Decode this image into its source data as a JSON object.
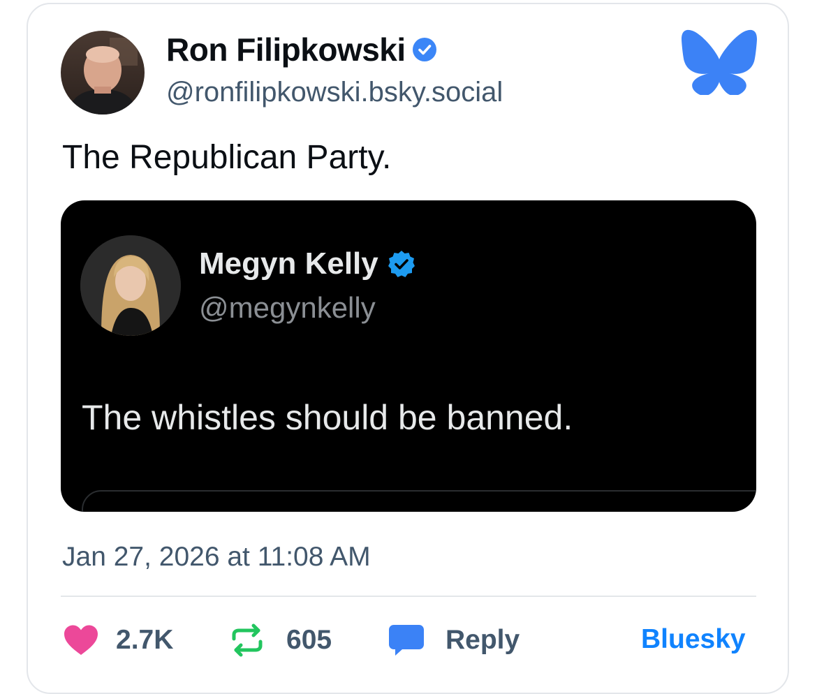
{
  "post": {
    "author": {
      "display_name": "Ron Filipkowski",
      "handle": "@ronfilipkowski.bsky.social",
      "verified": true
    },
    "text": "The Republican Party.",
    "embed": {
      "author": {
        "display_name": "Megyn Kelly",
        "handle": "@megynkelly",
        "verified": true
      },
      "text": "The whistles should be banned."
    },
    "timestamp": "Jan 27, 2026 at 11:08 AM",
    "stats": {
      "likes": "2.7K",
      "reposts": "605",
      "reply_label": "Reply"
    },
    "source_link": "Bluesky"
  },
  "colors": {
    "brand_blue": "#1083fe",
    "verified_blue": "#3b86f7",
    "like_pink": "#ec4899",
    "repost_green": "#22c55e",
    "reply_blue": "#3b82f6",
    "muted_text": "#42576c"
  },
  "icons": {
    "brand": "bluesky-butterfly-icon",
    "verified": "verified-check-icon",
    "like": "heart-icon",
    "repost": "repost-icon",
    "reply": "speech-bubble-icon"
  }
}
